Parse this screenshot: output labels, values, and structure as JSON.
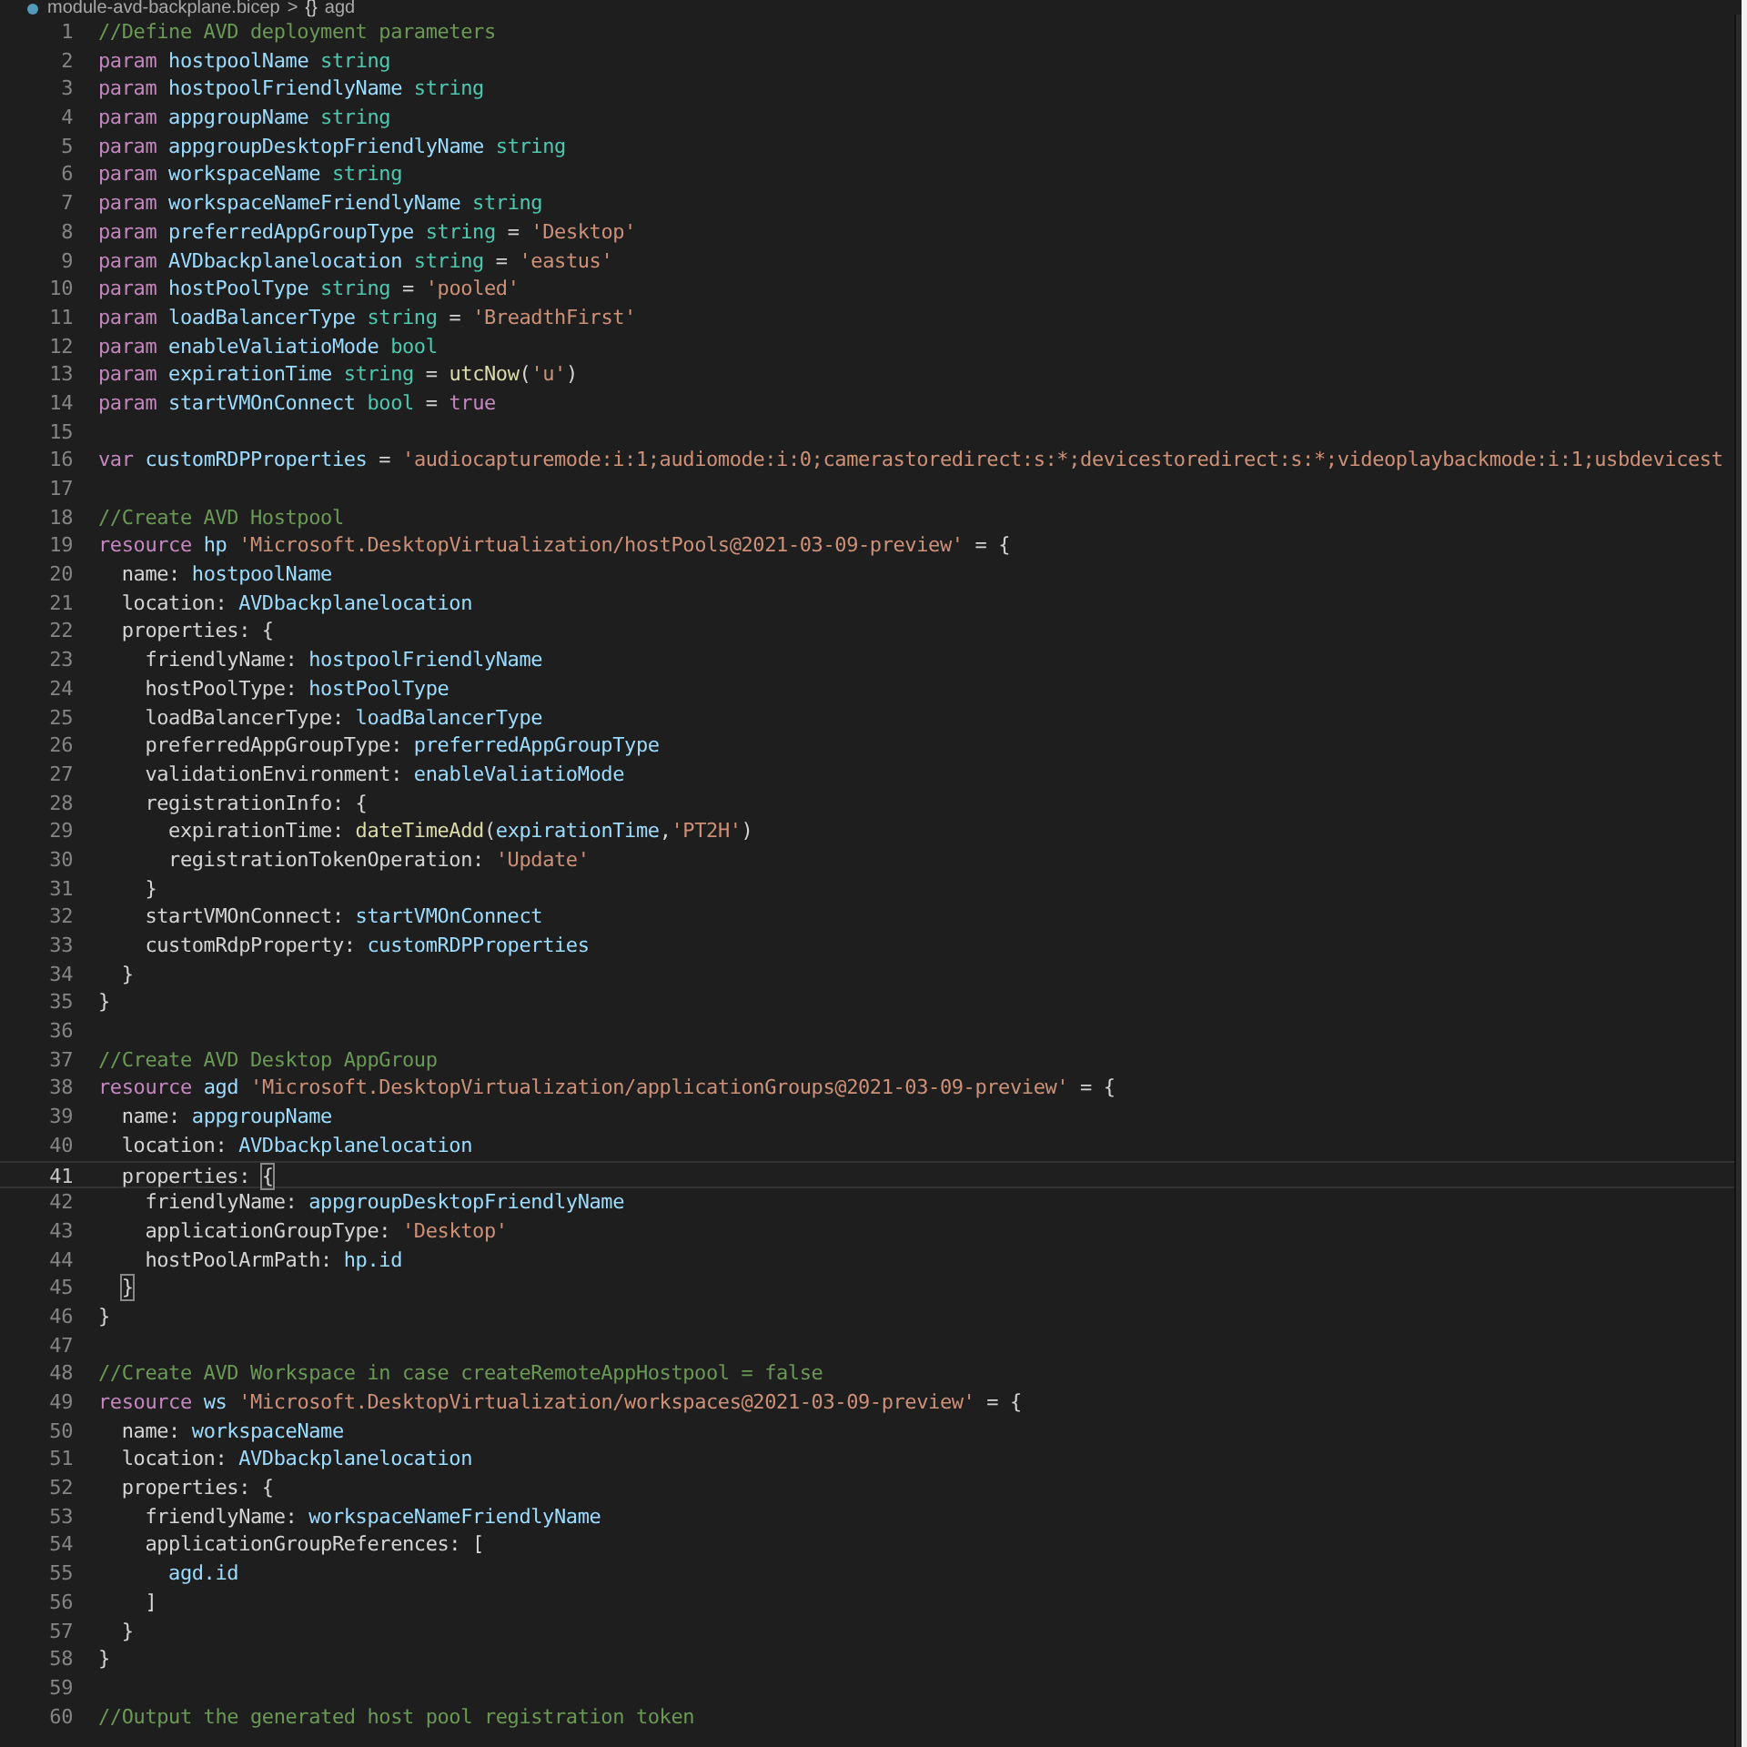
{
  "breadcrumb": {
    "file": "module-avd-backplane.bicep",
    "separator": ">",
    "symbol_icon": "{}",
    "symbol": "agd"
  },
  "editor": {
    "lines": [
      {
        "number": "1",
        "current": false,
        "tokens": [
          {
            "kind": "comment",
            "text": "//Define AVD deployment parameters"
          }
        ]
      },
      {
        "number": "2",
        "current": false,
        "tokens": [
          {
            "kind": "keyword",
            "text": "param "
          },
          {
            "kind": "ident",
            "text": "hostpoolName "
          },
          {
            "kind": "type",
            "text": "string"
          }
        ]
      },
      {
        "number": "3",
        "current": false,
        "tokens": [
          {
            "kind": "keyword",
            "text": "param "
          },
          {
            "kind": "ident",
            "text": "hostpoolFriendlyName "
          },
          {
            "kind": "type",
            "text": "string"
          }
        ]
      },
      {
        "number": "4",
        "current": false,
        "tokens": [
          {
            "kind": "keyword",
            "text": "param "
          },
          {
            "kind": "ident",
            "text": "appgroupName "
          },
          {
            "kind": "type",
            "text": "string"
          }
        ]
      },
      {
        "number": "5",
        "current": false,
        "tokens": [
          {
            "kind": "keyword",
            "text": "param "
          },
          {
            "kind": "ident",
            "text": "appgroupDesktopFriendlyName "
          },
          {
            "kind": "type",
            "text": "string"
          }
        ]
      },
      {
        "number": "6",
        "current": false,
        "tokens": [
          {
            "kind": "keyword",
            "text": "param "
          },
          {
            "kind": "ident",
            "text": "workspaceName "
          },
          {
            "kind": "type",
            "text": "string"
          }
        ]
      },
      {
        "number": "7",
        "current": false,
        "tokens": [
          {
            "kind": "keyword",
            "text": "param "
          },
          {
            "kind": "ident",
            "text": "workspaceNameFriendlyName "
          },
          {
            "kind": "type",
            "text": "string"
          }
        ]
      },
      {
        "number": "8",
        "current": false,
        "tokens": [
          {
            "kind": "keyword",
            "text": "param "
          },
          {
            "kind": "ident",
            "text": "preferredAppGroupType "
          },
          {
            "kind": "type",
            "text": "string"
          },
          {
            "kind": "plain",
            "text": " = "
          },
          {
            "kind": "string",
            "text": "'Desktop'"
          }
        ]
      },
      {
        "number": "9",
        "current": false,
        "tokens": [
          {
            "kind": "keyword",
            "text": "param "
          },
          {
            "kind": "ident",
            "text": "AVDbackplanelocation "
          },
          {
            "kind": "type",
            "text": "string"
          },
          {
            "kind": "plain",
            "text": " = "
          },
          {
            "kind": "string",
            "text": "'eastus'"
          }
        ]
      },
      {
        "number": "10",
        "current": false,
        "tokens": [
          {
            "kind": "keyword",
            "text": "param "
          },
          {
            "kind": "ident",
            "text": "hostPoolType "
          },
          {
            "kind": "type",
            "text": "string"
          },
          {
            "kind": "plain",
            "text": " = "
          },
          {
            "kind": "string",
            "text": "'pooled'"
          }
        ]
      },
      {
        "number": "11",
        "current": false,
        "tokens": [
          {
            "kind": "keyword",
            "text": "param "
          },
          {
            "kind": "ident",
            "text": "loadBalancerType "
          },
          {
            "kind": "type",
            "text": "string"
          },
          {
            "kind": "plain",
            "text": " = "
          },
          {
            "kind": "string",
            "text": "'BreadthFirst'"
          }
        ]
      },
      {
        "number": "12",
        "current": false,
        "tokens": [
          {
            "kind": "keyword",
            "text": "param "
          },
          {
            "kind": "ident",
            "text": "enableValiatioMode "
          },
          {
            "kind": "type",
            "text": "bool"
          }
        ]
      },
      {
        "number": "13",
        "current": false,
        "tokens": [
          {
            "kind": "keyword",
            "text": "param "
          },
          {
            "kind": "ident",
            "text": "expirationTime "
          },
          {
            "kind": "type",
            "text": "string"
          },
          {
            "kind": "plain",
            "text": " = "
          },
          {
            "kind": "func",
            "text": "utcNow"
          },
          {
            "kind": "plain",
            "text": "("
          },
          {
            "kind": "string",
            "text": "'u'"
          },
          {
            "kind": "plain",
            "text": ")"
          }
        ]
      },
      {
        "number": "14",
        "current": false,
        "tokens": [
          {
            "kind": "keyword",
            "text": "param "
          },
          {
            "kind": "ident",
            "text": "startVMOnConnect "
          },
          {
            "kind": "type",
            "text": "bool"
          },
          {
            "kind": "plain",
            "text": " = "
          },
          {
            "kind": "keyword",
            "text": "true"
          }
        ]
      },
      {
        "number": "15",
        "current": false
      },
      {
        "number": "16",
        "current": false,
        "tokens": [
          {
            "kind": "keyword",
            "text": "var "
          },
          {
            "kind": "ident",
            "text": "customRDPProperties"
          },
          {
            "kind": "plain",
            "text": " = "
          },
          {
            "kind": "string",
            "text": "'audiocapturemode:i:1;audiomode:i:0;camerastoredirect:s:*;devicestoredirect:s:*;videoplaybackmode:i:1;usbdevicest"
          }
        ]
      },
      {
        "number": "17",
        "current": false
      },
      {
        "number": "18",
        "current": false,
        "tokens": [
          {
            "kind": "comment",
            "text": "//Create AVD Hostpool"
          }
        ]
      },
      {
        "number": "19",
        "current": false,
        "tokens": [
          {
            "kind": "keyword",
            "text": "resource "
          },
          {
            "kind": "ident",
            "text": "hp "
          },
          {
            "kind": "string",
            "text": "'Microsoft.DesktopVirtualization/hostPools@2021-03-09-preview'"
          },
          {
            "kind": "plain",
            "text": " = {"
          }
        ]
      },
      {
        "number": "20",
        "current": false,
        "tokens": [
          {
            "kind": "plain",
            "text": "  name: "
          },
          {
            "kind": "ident",
            "text": "hostpoolName"
          }
        ]
      },
      {
        "number": "21",
        "current": false,
        "tokens": [
          {
            "kind": "plain",
            "text": "  location: "
          },
          {
            "kind": "ident",
            "text": "AVDbackplanelocation"
          }
        ]
      },
      {
        "number": "22",
        "current": false,
        "tokens": [
          {
            "kind": "plain",
            "text": "  properties: {"
          }
        ]
      },
      {
        "number": "23",
        "current": false,
        "tokens": [
          {
            "kind": "plain",
            "text": "    friendlyName: "
          },
          {
            "kind": "ident",
            "text": "hostpoolFriendlyName"
          }
        ]
      },
      {
        "number": "24",
        "current": false,
        "tokens": [
          {
            "kind": "plain",
            "text": "    hostPoolType: "
          },
          {
            "kind": "ident",
            "text": "hostPoolType"
          }
        ]
      },
      {
        "number": "25",
        "current": false,
        "tokens": [
          {
            "kind": "plain",
            "text": "    loadBalancerType: "
          },
          {
            "kind": "ident",
            "text": "loadBalancerType"
          }
        ]
      },
      {
        "number": "26",
        "current": false,
        "tokens": [
          {
            "kind": "plain",
            "text": "    preferredAppGroupType: "
          },
          {
            "kind": "ident",
            "text": "preferredAppGroupType"
          }
        ]
      },
      {
        "number": "27",
        "current": false,
        "tokens": [
          {
            "kind": "plain",
            "text": "    validationEnvironment: "
          },
          {
            "kind": "ident",
            "text": "enableValiatioMode"
          }
        ]
      },
      {
        "number": "28",
        "current": false,
        "tokens": [
          {
            "kind": "plain",
            "text": "    registrationInfo: {"
          }
        ]
      },
      {
        "number": "29",
        "current": false,
        "tokens": [
          {
            "kind": "plain",
            "text": "      expirationTime: "
          },
          {
            "kind": "func",
            "text": "dateTimeAdd"
          },
          {
            "kind": "plain",
            "text": "("
          },
          {
            "kind": "ident",
            "text": "expirationTime"
          },
          {
            "kind": "plain",
            "text": ","
          },
          {
            "kind": "string",
            "text": "'PT2H'"
          },
          {
            "kind": "plain",
            "text": ")"
          }
        ]
      },
      {
        "number": "30",
        "current": false,
        "tokens": [
          {
            "kind": "plain",
            "text": "      registrationTokenOperation: "
          },
          {
            "kind": "string",
            "text": "'Update'"
          }
        ]
      },
      {
        "number": "31",
        "current": false,
        "tokens": [
          {
            "kind": "plain",
            "text": "    }"
          }
        ]
      },
      {
        "number": "32",
        "current": false,
        "tokens": [
          {
            "kind": "plain",
            "text": "    startVMOnConnect: "
          },
          {
            "kind": "ident",
            "text": "startVMOnConnect"
          }
        ]
      },
      {
        "number": "33",
        "current": false,
        "tokens": [
          {
            "kind": "plain",
            "text": "    customRdpProperty: "
          },
          {
            "kind": "ident",
            "text": "customRDPProperties"
          }
        ]
      },
      {
        "number": "34",
        "current": false,
        "tokens": [
          {
            "kind": "plain",
            "text": "  }"
          }
        ]
      },
      {
        "number": "35",
        "current": false,
        "tokens": [
          {
            "kind": "plain",
            "text": "}"
          }
        ]
      },
      {
        "number": "36",
        "current": false
      },
      {
        "number": "37",
        "current": false,
        "tokens": [
          {
            "kind": "comment",
            "text": "//Create AVD Desktop AppGroup"
          }
        ]
      },
      {
        "number": "38",
        "current": false,
        "tokens": [
          {
            "kind": "keyword",
            "text": "resource "
          },
          {
            "kind": "ident",
            "text": "agd "
          },
          {
            "kind": "string",
            "text": "'Microsoft.DesktopVirtualization/applicationGroups@2021-03-09-preview'"
          },
          {
            "kind": "plain",
            "text": " = {"
          }
        ]
      },
      {
        "number": "39",
        "current": false,
        "tokens": [
          {
            "kind": "plain",
            "text": "  name: "
          },
          {
            "kind": "ident",
            "text": "appgroupName"
          }
        ]
      },
      {
        "number": "40",
        "current": false,
        "tokens": [
          {
            "kind": "plain",
            "text": "  location: "
          },
          {
            "kind": "ident",
            "text": "AVDbackplanelocation"
          }
        ]
      },
      {
        "number": "41",
        "current": true,
        "tokens": [
          {
            "kind": "plain",
            "text": "  properties: "
          },
          {
            "kind": "match",
            "text": "{"
          }
        ]
      },
      {
        "number": "42",
        "current": false,
        "tokens": [
          {
            "kind": "plain",
            "text": "    friendlyName: "
          },
          {
            "kind": "ident",
            "text": "appgroupDesktopFriendlyName"
          }
        ]
      },
      {
        "number": "43",
        "current": false,
        "tokens": [
          {
            "kind": "plain",
            "text": "    applicationGroupType: "
          },
          {
            "kind": "string",
            "text": "'Desktop'"
          }
        ]
      },
      {
        "number": "44",
        "current": false,
        "tokens": [
          {
            "kind": "plain",
            "text": "    hostPoolArmPath: "
          },
          {
            "kind": "ident",
            "text": "hp.id"
          }
        ]
      },
      {
        "number": "45",
        "current": false,
        "tokens": [
          {
            "kind": "match",
            "text": "  }"
          }
        ]
      },
      {
        "number": "46",
        "current": false,
        "tokens": [
          {
            "kind": "plain",
            "text": "}"
          }
        ]
      },
      {
        "number": "47",
        "current": false
      },
      {
        "number": "48",
        "current": false,
        "tokens": [
          {
            "kind": "comment",
            "text": "//Create AVD Workspace in case createRemoteAppHostpool = false"
          }
        ]
      },
      {
        "number": "49",
        "current": false,
        "tokens": [
          {
            "kind": "keyword",
            "text": "resource "
          },
          {
            "kind": "ident",
            "text": "ws "
          },
          {
            "kind": "string",
            "text": "'Microsoft.DesktopVirtualization/workspaces@2021-03-09-preview'"
          },
          {
            "kind": "plain",
            "text": " = {"
          }
        ]
      },
      {
        "number": "50",
        "current": false,
        "tokens": [
          {
            "kind": "plain",
            "text": "  name: "
          },
          {
            "kind": "ident",
            "text": "workspaceName"
          }
        ]
      },
      {
        "number": "51",
        "current": false,
        "tokens": [
          {
            "kind": "plain",
            "text": "  location: "
          },
          {
            "kind": "ident",
            "text": "AVDbackplanelocation"
          }
        ]
      },
      {
        "number": "52",
        "current": false,
        "tokens": [
          {
            "kind": "plain",
            "text": "  properties: {"
          }
        ]
      },
      {
        "number": "53",
        "current": false,
        "tokens": [
          {
            "kind": "plain",
            "text": "    friendlyName: "
          },
          {
            "kind": "ident",
            "text": "workspaceNameFriendlyName"
          }
        ]
      },
      {
        "number": "54",
        "current": false,
        "tokens": [
          {
            "kind": "plain",
            "text": "    applicationGroupReferences: ["
          }
        ]
      },
      {
        "number": "55",
        "current": false,
        "tokens": [
          {
            "kind": "ident",
            "text": "      agd.id"
          }
        ]
      },
      {
        "number": "56",
        "current": false,
        "tokens": [
          {
            "kind": "plain",
            "text": "    ]"
          }
        ]
      },
      {
        "number": "57",
        "current": false,
        "tokens": [
          {
            "kind": "plain",
            "text": "  }"
          }
        ]
      },
      {
        "number": "58",
        "current": false,
        "tokens": [
          {
            "kind": "plain",
            "text": "}"
          }
        ]
      },
      {
        "number": "59",
        "current": false
      },
      {
        "number": "60",
        "current": false,
        "tokens": [
          {
            "kind": "comment",
            "text": "//Output the generated host pool registration token"
          }
        ]
      }
    ]
  }
}
